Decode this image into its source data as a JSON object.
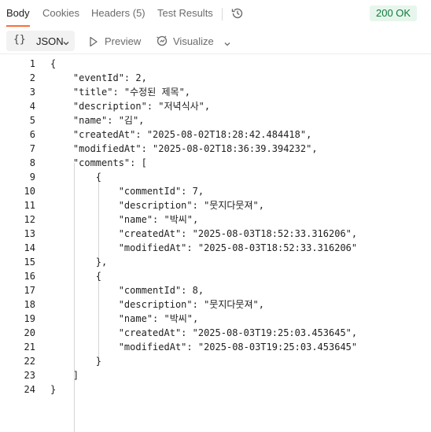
{
  "tabs": [
    {
      "label": "Body"
    },
    {
      "label": "Cookies"
    },
    {
      "label": "Headers (5)"
    },
    {
      "label": "Test Results"
    }
  ],
  "status": {
    "text": "200 OK",
    "color": "#0d7a3b"
  },
  "toolbar": {
    "format_braces": "{}",
    "format_label": "JSON",
    "preview_label": "Preview",
    "visualize_label": "Visualize"
  },
  "code": {
    "lines": [
      {
        "n": "1",
        "text": "{"
      },
      {
        "n": "2",
        "text": "    \"eventId\": 2,"
      },
      {
        "n": "3",
        "text": "    \"title\": \"수정된 제목\","
      },
      {
        "n": "4",
        "text": "    \"description\": \"저녁식사\","
      },
      {
        "n": "5",
        "text": "    \"name\": \"김\","
      },
      {
        "n": "6",
        "text": "    \"createdAt\": \"2025-08-02T18:28:42.484418\","
      },
      {
        "n": "7",
        "text": "    \"modifiedAt\": \"2025-08-02T18:36:39.394232\","
      },
      {
        "n": "8",
        "text": "    \"comments\": ["
      },
      {
        "n": "9",
        "text": "        {"
      },
      {
        "n": "10",
        "text": "            \"commentId\": 7,"
      },
      {
        "n": "11",
        "text": "            \"description\": \"뭇지다뭇져\","
      },
      {
        "n": "12",
        "text": "            \"name\": \"박씨\","
      },
      {
        "n": "13",
        "text": "            \"createdAt\": \"2025-08-03T18:52:33.316206\","
      },
      {
        "n": "14",
        "text": "            \"modifiedAt\": \"2025-08-03T18:52:33.316206\""
      },
      {
        "n": "15",
        "text": "        },"
      },
      {
        "n": "16",
        "text": "        {"
      },
      {
        "n": "17",
        "text": "            \"commentId\": 8,"
      },
      {
        "n": "18",
        "text": "            \"description\": \"뭇지다뭇져\","
      },
      {
        "n": "19",
        "text": "            \"name\": \"박씨\","
      },
      {
        "n": "20",
        "text": "            \"createdAt\": \"2025-08-03T19:25:03.453645\","
      },
      {
        "n": "21",
        "text": "            \"modifiedAt\": \"2025-08-03T19:25:03.453645\""
      },
      {
        "n": "22",
        "text": "        }"
      },
      {
        "n": "23",
        "text": "    ]"
      },
      {
        "n": "24",
        "text": "}"
      }
    ]
  }
}
